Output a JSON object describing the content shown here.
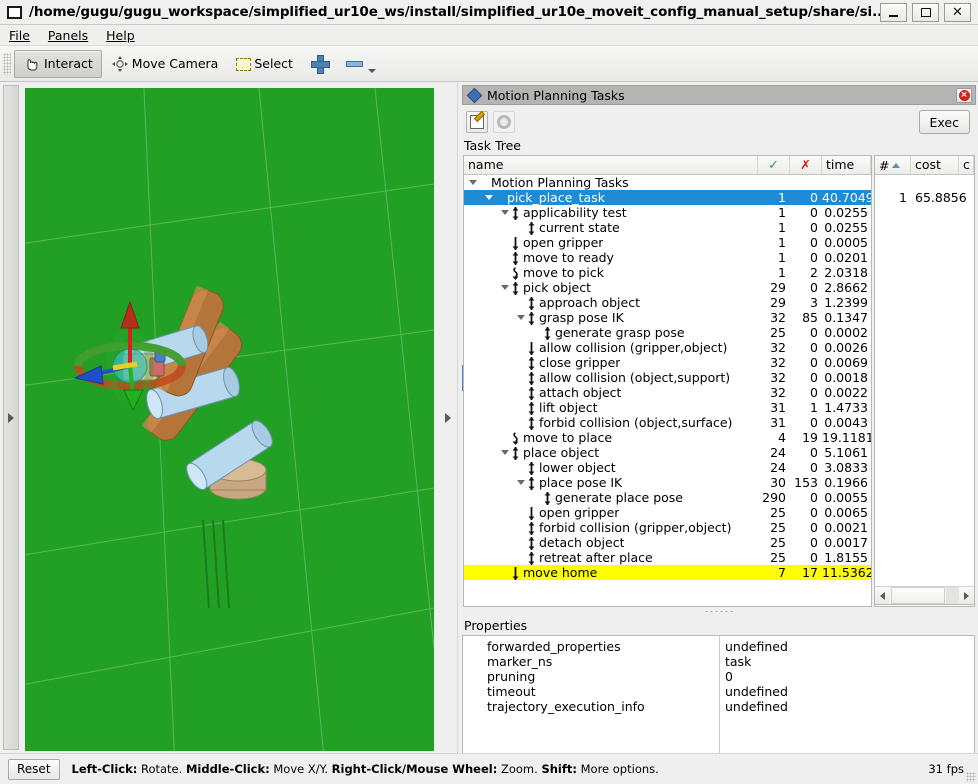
{
  "window": {
    "title": "/home/gugu/gugu_workspace/simplified_ur10e_ws/install/simplified_ur10e_moveit_config_manual_setup/share/si...",
    "minimize_label": "_",
    "maximize_label": "□",
    "close_label": "✕"
  },
  "menubar": {
    "items": [
      {
        "label": "File"
      },
      {
        "label": "Panels"
      },
      {
        "label": "Help"
      }
    ]
  },
  "toolbar": {
    "items": [
      {
        "label": "Interact",
        "icon": "hand-cursor-icon",
        "active": true
      },
      {
        "label": "Move Camera",
        "icon": "move-camera-icon",
        "active": false
      },
      {
        "label": "Select",
        "icon": "select-rect-icon",
        "active": false
      },
      {
        "label": "",
        "icon": "plus-icon",
        "active": false
      },
      {
        "label": "",
        "icon": "minus-icon",
        "active": false
      }
    ]
  },
  "viewport": {
    "background_color": "#22a024",
    "grid_color": "#6fc46f"
  },
  "panel": {
    "title": "Motion Planning Tasks",
    "title_icon": "rviz-diamond-icon",
    "close_icon": "close-icon",
    "buttons": [
      {
        "name": "edit-button",
        "icon": "pencil-note-icon"
      },
      {
        "name": "settings-button",
        "icon": "gear-icon"
      }
    ],
    "exec_label": "Exec",
    "task_tree_label": "Task Tree",
    "properties_label": "Properties"
  },
  "tree": {
    "columns_left": [
      {
        "key": "name",
        "label": "name"
      },
      {
        "key": "ok",
        "label": "✓"
      },
      {
        "key": "fail",
        "label": "✗"
      },
      {
        "key": "time",
        "label": "time"
      }
    ],
    "columns_right": [
      {
        "key": "num",
        "label": "#"
      },
      {
        "key": "cost",
        "label": "cost"
      },
      {
        "key": "more",
        "label": "c"
      }
    ],
    "rows": [
      {
        "depth": 0,
        "name": "Motion Planning Tasks",
        "ok": "",
        "fail": "",
        "time": "",
        "twisty": "open",
        "stage": "none",
        "state": "normal",
        "num": "",
        "cost": ""
      },
      {
        "depth": 1,
        "name": "pick_place_task",
        "ok": "1",
        "fail": "0",
        "time": "40.7049",
        "twisty": "open",
        "stage": "none",
        "state": "selected",
        "num": "1",
        "cost": "65.8856"
      },
      {
        "depth": 2,
        "name": "applicability test",
        "ok": "1",
        "fail": "0",
        "time": "0.0255",
        "twisty": "open",
        "stage": "both",
        "state": "normal",
        "num": "",
        "cost": ""
      },
      {
        "depth": 3,
        "name": "current state",
        "ok": "1",
        "fail": "0",
        "time": "0.0255",
        "twisty": "none",
        "stage": "both",
        "state": "normal",
        "num": "",
        "cost": ""
      },
      {
        "depth": 2,
        "name": "open gripper",
        "ok": "1",
        "fail": "0",
        "time": "0.0005",
        "twisty": "none",
        "stage": "down",
        "state": "normal",
        "num": "",
        "cost": ""
      },
      {
        "depth": 2,
        "name": "move to ready",
        "ok": "1",
        "fail": "0",
        "time": "0.0201",
        "twisty": "none",
        "stage": "both",
        "state": "normal",
        "num": "",
        "cost": ""
      },
      {
        "depth": 2,
        "name": "move to pick",
        "ok": "1",
        "fail": "2",
        "time": "2.0318",
        "twisty": "none",
        "stage": "connect",
        "state": "normal",
        "num": "",
        "cost": ""
      },
      {
        "depth": 2,
        "name": "pick object",
        "ok": "29",
        "fail": "0",
        "time": "2.8662",
        "twisty": "open",
        "stage": "both",
        "state": "normal",
        "num": "",
        "cost": ""
      },
      {
        "depth": 3,
        "name": "approach object",
        "ok": "29",
        "fail": "3",
        "time": "1.2399",
        "twisty": "none",
        "stage": "both",
        "state": "normal",
        "num": "",
        "cost": ""
      },
      {
        "depth": 3,
        "name": "grasp pose IK",
        "ok": "32",
        "fail": "85",
        "time": "0.1347",
        "twisty": "open",
        "stage": "both",
        "state": "normal",
        "num": "",
        "cost": ""
      },
      {
        "depth": 4,
        "name": "generate grasp pose",
        "ok": "25",
        "fail": "0",
        "time": "0.0002",
        "twisty": "none",
        "stage": "both",
        "state": "normal",
        "num": "",
        "cost": ""
      },
      {
        "depth": 3,
        "name": "allow collision (gripper,object)",
        "ok": "32",
        "fail": "0",
        "time": "0.0026",
        "twisty": "none",
        "stage": "down",
        "state": "normal",
        "num": "",
        "cost": ""
      },
      {
        "depth": 3,
        "name": "close gripper",
        "ok": "32",
        "fail": "0",
        "time": "0.0069",
        "twisty": "none",
        "stage": "both",
        "state": "normal",
        "num": "",
        "cost": ""
      },
      {
        "depth": 3,
        "name": "allow collision (object,support)",
        "ok": "32",
        "fail": "0",
        "time": "0.0018",
        "twisty": "none",
        "stage": "both",
        "state": "normal",
        "num": "",
        "cost": ""
      },
      {
        "depth": 3,
        "name": "attach object",
        "ok": "32",
        "fail": "0",
        "time": "0.0022",
        "twisty": "none",
        "stage": "both",
        "state": "normal",
        "num": "",
        "cost": ""
      },
      {
        "depth": 3,
        "name": "lift object",
        "ok": "31",
        "fail": "1",
        "time": "1.4733",
        "twisty": "none",
        "stage": "both",
        "state": "normal",
        "num": "",
        "cost": ""
      },
      {
        "depth": 3,
        "name": "forbid collision (object,surface)",
        "ok": "31",
        "fail": "0",
        "time": "0.0043",
        "twisty": "none",
        "stage": "both",
        "state": "normal",
        "num": "",
        "cost": ""
      },
      {
        "depth": 2,
        "name": "move to place",
        "ok": "4",
        "fail": "19",
        "time": "19.1181",
        "twisty": "none",
        "stage": "connect",
        "state": "normal",
        "num": "",
        "cost": ""
      },
      {
        "depth": 2,
        "name": "place object",
        "ok": "24",
        "fail": "0",
        "time": "5.1061",
        "twisty": "open",
        "stage": "both",
        "state": "normal",
        "num": "",
        "cost": ""
      },
      {
        "depth": 3,
        "name": "lower object",
        "ok": "24",
        "fail": "0",
        "time": "3.0833",
        "twisty": "none",
        "stage": "both",
        "state": "normal",
        "num": "",
        "cost": ""
      },
      {
        "depth": 3,
        "name": "place pose IK",
        "ok": "30",
        "fail": "153",
        "time": "0.1966",
        "twisty": "open",
        "stage": "both",
        "state": "normal",
        "num": "",
        "cost": ""
      },
      {
        "depth": 4,
        "name": "generate place pose",
        "ok": "290",
        "fail": "0",
        "time": "0.0055",
        "twisty": "none",
        "stage": "both",
        "state": "normal",
        "num": "",
        "cost": ""
      },
      {
        "depth": 3,
        "name": "open gripper",
        "ok": "25",
        "fail": "0",
        "time": "0.0065",
        "twisty": "none",
        "stage": "down",
        "state": "normal",
        "num": "",
        "cost": ""
      },
      {
        "depth": 3,
        "name": "forbid collision (gripper,object)",
        "ok": "25",
        "fail": "0",
        "time": "0.0021",
        "twisty": "none",
        "stage": "both",
        "state": "normal",
        "num": "",
        "cost": ""
      },
      {
        "depth": 3,
        "name": "detach object",
        "ok": "25",
        "fail": "0",
        "time": "0.0017",
        "twisty": "none",
        "stage": "both",
        "state": "normal",
        "num": "",
        "cost": ""
      },
      {
        "depth": 3,
        "name": "retreat after place",
        "ok": "25",
        "fail": "0",
        "time": "1.8155",
        "twisty": "none",
        "stage": "both",
        "state": "normal",
        "num": "",
        "cost": ""
      },
      {
        "depth": 2,
        "name": "move home",
        "ok": "7",
        "fail": "17",
        "time": "11.5362",
        "twisty": "none",
        "stage": "down",
        "state": "highlighted",
        "num": "",
        "cost": ""
      }
    ]
  },
  "properties": {
    "rows": [
      {
        "key": "forwarded_properties",
        "value": "undefined"
      },
      {
        "key": "marker_ns",
        "value": "task"
      },
      {
        "key": "pruning",
        "value": "0"
      },
      {
        "key": "timeout",
        "value": "undefined"
      },
      {
        "key": "trajectory_execution_info",
        "value": "undefined"
      }
    ]
  },
  "statusbar": {
    "reset_label": "Reset",
    "hint_parts": [
      {
        "text": "Left-Click:",
        "bold": true
      },
      {
        "text": " Rotate. ",
        "bold": false
      },
      {
        "text": "Middle-Click:",
        "bold": true
      },
      {
        "text": " Move X/Y. ",
        "bold": false
      },
      {
        "text": "Right-Click/Mouse Wheel:",
        "bold": true
      },
      {
        "text": " Zoom. ",
        "bold": false
      },
      {
        "text": "Shift:",
        "bold": true
      },
      {
        "text": " More options.",
        "bold": false
      }
    ],
    "fps": "31 fps"
  }
}
